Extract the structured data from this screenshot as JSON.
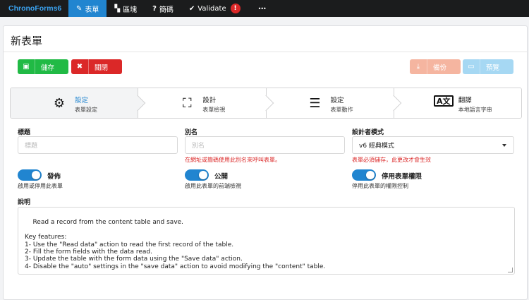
{
  "nav": {
    "brand": "ChronoForms6",
    "items": [
      {
        "label": "表單",
        "icon": "edit-icon"
      },
      {
        "label": "區塊",
        "icon": "sitemap-icon"
      },
      {
        "label": "簡碼",
        "icon": "question-icon"
      },
      {
        "label": "Validate",
        "icon": "check-icon",
        "badge": "!"
      },
      {
        "label": "•••",
        "icon": "more-icon"
      }
    ]
  },
  "page": {
    "title": "新表單"
  },
  "toolbar": {
    "save_label": "儲存",
    "close_label": "關閉",
    "copy_label": "備份",
    "preview_label": "預覽"
  },
  "steps": [
    {
      "title": "設定",
      "desc": "表單設定",
      "icon": "cogs-icon",
      "active": true
    },
    {
      "title": "設計",
      "desc": "表單檢視",
      "icon": "object-group-icon",
      "active": false
    },
    {
      "title": "設定",
      "desc": "表單動作",
      "icon": "tasks-icon",
      "active": false
    },
    {
      "title": "翻譯",
      "desc": "本地語言字串",
      "icon": "language-icon",
      "active": false
    }
  ],
  "form": {
    "title_label": "標題",
    "title_placeholder": "標題",
    "alias_label": "別名",
    "alias_placeholder": "別名",
    "alias_hint": "在網址或簡碼使用此別名來呼叫表單。",
    "designer_label": "設計者模式",
    "designer_value": "v6 經典模式",
    "designer_hint": "表單必須儲存，此更改才會生效",
    "publish_label": "發佈",
    "publish_hint": "啟用或停用此表單",
    "public_label": "公開",
    "public_hint": "啟用此表單的前端檢視",
    "perm_label": "停用表單權限",
    "perm_hint": "停用此表單的權限控制",
    "desc_label": "說明",
    "desc_text": "Read a record from the content table and save.\n\nKey features:\n1- Use the \"Read data\" action to read the first record of the table.\n2- Fill the form fields with the data read.\n3- Update the table with the form data using the \"Save data\" action.\n4- Disable the \"auto\" settings in the \"save data\" action to avoid modifying the \"content\" table."
  },
  "colors": {
    "primary": "#2185d0",
    "success": "#21ba45",
    "danger": "#db2828",
    "navbar": "#1b1c1d"
  }
}
